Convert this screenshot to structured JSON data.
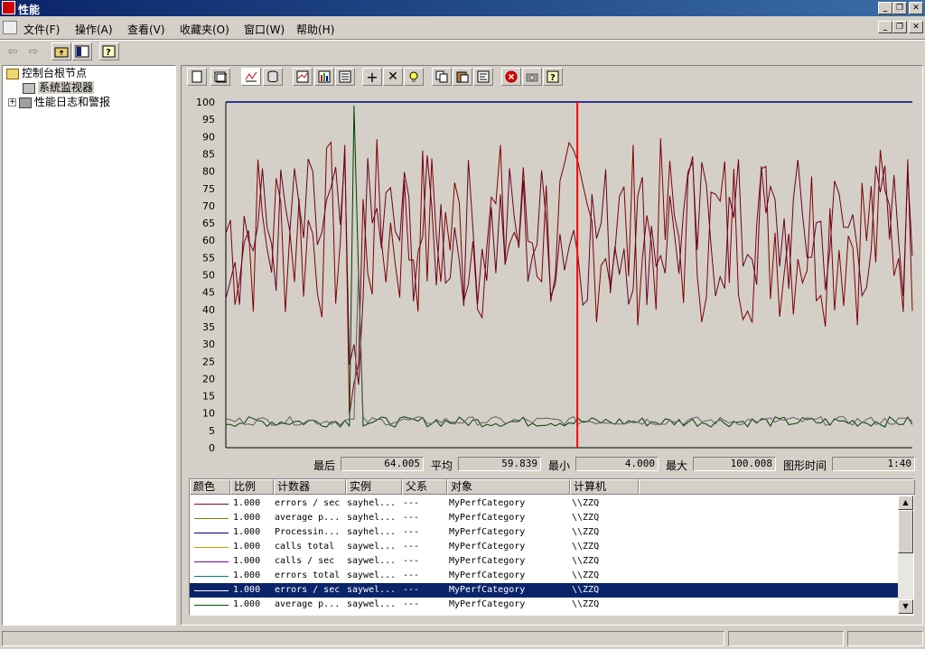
{
  "window": {
    "title": "性能"
  },
  "menu": {
    "items": [
      "文件(F)",
      "操作(A)",
      "查看(V)",
      "收藏夹(O)",
      "窗口(W)",
      "帮助(H)"
    ]
  },
  "tree": {
    "root": "控制台根节点",
    "child1": "系统监视器",
    "child2": "性能日志和警报"
  },
  "chart": {
    "y_ticks": [
      "100",
      "95",
      "90",
      "85",
      "80",
      "75",
      "70",
      "65",
      "60",
      "55",
      "50",
      "45",
      "40",
      "35",
      "30",
      "25",
      "20",
      "15",
      "10",
      "5",
      "0"
    ]
  },
  "stats": {
    "last_label": "最后",
    "last": "64.005",
    "avg_label": "平均",
    "avg": "59.839",
    "min_label": "最小",
    "min": "4.000",
    "max_label": "最大",
    "max": "100.008",
    "time_label": "图形时间",
    "time": "1:40"
  },
  "table": {
    "headers": [
      "颜色",
      "比例",
      "计数器",
      "实例",
      "父系",
      "对象",
      "计算机"
    ],
    "rows": [
      {
        "color": "#800040",
        "scale": "1.000",
        "counter": "errors / sec",
        "instance": "sayhel...",
        "parent": "---",
        "object": "MyPerfCategory",
        "computer": "\\\\ZZQ"
      },
      {
        "color": "#808000",
        "scale": "1.000",
        "counter": "average p...",
        "instance": "sayhel...",
        "parent": "---",
        "object": "MyPerfCategory",
        "computer": "\\\\ZZQ"
      },
      {
        "color": "#000080",
        "scale": "1.000",
        "counter": "Processin...",
        "instance": "sayhel...",
        "parent": "---",
        "object": "MyPerfCategory",
        "computer": "\\\\ZZQ"
      },
      {
        "color": "#c0a000",
        "scale": "1.000",
        "counter": "calls total",
        "instance": "saywel...",
        "parent": "---",
        "object": "MyPerfCategory",
        "computer": "\\\\ZZQ"
      },
      {
        "color": "#8000a0",
        "scale": "1.000",
        "counter": "calls / sec",
        "instance": "saywel...",
        "parent": "---",
        "object": "MyPerfCategory",
        "computer": "\\\\ZZQ"
      },
      {
        "color": "#008080",
        "scale": "1.000",
        "counter": "errors total",
        "instance": "saywel...",
        "parent": "---",
        "object": "MyPerfCategory",
        "computer": "\\\\ZZQ"
      },
      {
        "color": "#0a246a",
        "scale": "1.000",
        "counter": "errors / sec",
        "instance": "saywel...",
        "parent": "---",
        "object": "MyPerfCategory",
        "computer": "\\\\ZZQ",
        "selected": true
      },
      {
        "color": "#005000",
        "scale": "1.000",
        "counter": "average p...",
        "instance": "saywel...",
        "parent": "---",
        "object": "MyPerfCategory",
        "computer": "\\\\ZZQ"
      }
    ]
  }
}
